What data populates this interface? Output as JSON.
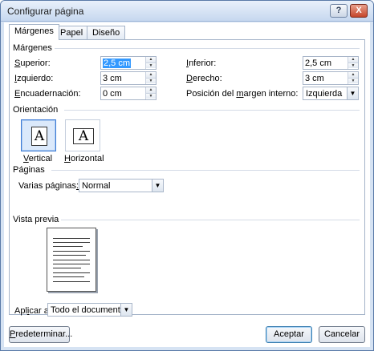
{
  "window": {
    "title": "Configurar página",
    "help_button": "?",
    "close_button": "X"
  },
  "tabs": [
    {
      "label": "Márgenes",
      "active": true
    },
    {
      "label": "Papel",
      "active": false
    },
    {
      "label": "Diseño",
      "active": false
    }
  ],
  "margins": {
    "group_label": "Márgenes",
    "superior": {
      "label_pre": "S",
      "label_post": "uperior:",
      "value": "2,5 cm"
    },
    "inferior": {
      "label_pre": "I",
      "label_post": "nferior:",
      "value": "2,5 cm"
    },
    "izquierdo": {
      "label_pre": "I",
      "label_post": "zquierdo:",
      "value": "3 cm"
    },
    "derecho": {
      "label_pre": "D",
      "label_post": "erecho:",
      "value": "3 cm"
    },
    "encuadernacion": {
      "label_pre": "E",
      "label_post": "ncuadernación:",
      "value": "0 cm"
    },
    "posicion_margen": {
      "label_pre": "Posición del ",
      "label_u": "m",
      "label_post": "argen interno:",
      "value": "Izquierda"
    }
  },
  "orientation": {
    "group_label": "Orientación",
    "vertical": {
      "label_pre": "",
      "label_u": "V",
      "label_post": "ertical",
      "glyph": "A",
      "selected": true
    },
    "horizontal": {
      "label_pre": "",
      "label_u": "H",
      "label_post": "orizontal",
      "glyph": "A",
      "selected": false
    }
  },
  "pages": {
    "group_label": "Páginas",
    "varias_label_pre": "Varias páginas",
    "varias_label_u": ":",
    "varias_value": "Normal"
  },
  "preview": {
    "group_label": "Vista previa"
  },
  "apply": {
    "label_pre": "Apl",
    "label_u": "i",
    "label_post": "car a:",
    "value": "Todo el documento"
  },
  "buttons": {
    "default_pre": "",
    "default_u": "P",
    "default_post": "redeterminar...",
    "ok": "Aceptar",
    "cancel": "Cancelar"
  },
  "icons": {
    "spin_up": "up-arrow-icon",
    "spin_down": "down-arrow-icon",
    "dropdown": "dropdown-arrow-icon"
  }
}
